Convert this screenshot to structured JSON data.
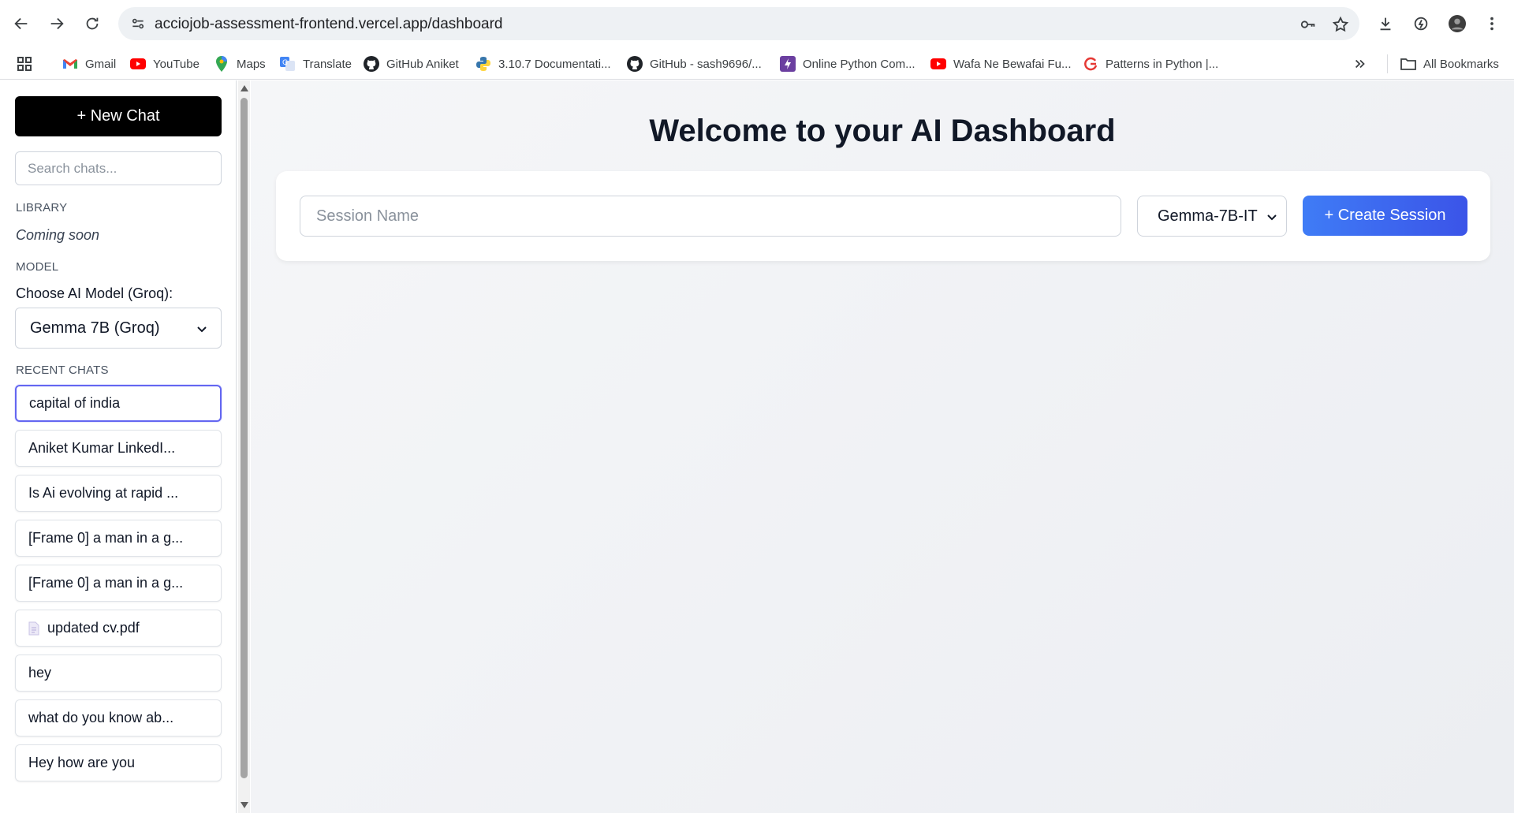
{
  "browser": {
    "url": "acciojob-assessment-frontend.vercel.app/dashboard",
    "bookmarks": [
      {
        "label": "Gmail",
        "icon": "gmail-icon"
      },
      {
        "label": "YouTube",
        "icon": "youtube-icon"
      },
      {
        "label": "Maps",
        "icon": "maps-icon"
      },
      {
        "label": "Translate",
        "icon": "translate-icon"
      },
      {
        "label": "GitHub Aniket",
        "icon": "github-icon"
      },
      {
        "label": "3.10.7 Documentati...",
        "icon": "python-icon"
      },
      {
        "label": "GitHub - sash9696/...",
        "icon": "github-icon"
      },
      {
        "label": "Online Python Com...",
        "icon": "bolt-icon"
      },
      {
        "label": "Wafa Ne Bewafai Fu...",
        "icon": "youtube-icon"
      },
      {
        "label": "Patterns in Python |...",
        "icon": "refresh-logo-icon"
      }
    ],
    "all_bookmarks": "All Bookmarks"
  },
  "sidebar": {
    "new_chat_label": "+ New Chat",
    "search_placeholder": "Search chats...",
    "library_label": "LIBRARY",
    "library_text": "Coming soon",
    "model_label": "MODEL",
    "choose_model_label": "Choose AI Model (Groq):",
    "model_selected": "Gemma 7B (Groq)",
    "recent_label": "RECENT CHATS",
    "chats": [
      {
        "title": "capital of india",
        "active": true,
        "file": false
      },
      {
        "title": "Aniket Kumar LinkedI...",
        "active": false,
        "file": false
      },
      {
        "title": "Is Ai evolving at rapid ...",
        "active": false,
        "file": false
      },
      {
        "title": "[Frame 0] a man in a g...",
        "active": false,
        "file": false
      },
      {
        "title": "[Frame 0] a man in a g...",
        "active": false,
        "file": false
      },
      {
        "title": "updated cv.pdf",
        "active": false,
        "file": true
      },
      {
        "title": "hey",
        "active": false,
        "file": false
      },
      {
        "title": "what do you know ab...",
        "active": false,
        "file": false
      },
      {
        "title": "Hey how are you",
        "active": false,
        "file": false
      }
    ]
  },
  "main": {
    "welcome_title": "Welcome to your AI Dashboard",
    "session_placeholder": "Session Name",
    "session_model": "Gemma-7B-IT",
    "create_label": "+ Create Session"
  },
  "colors": {
    "accent": "#3b5ce8",
    "active_border": "#6366f1",
    "new_chat_bg": "#000000"
  }
}
